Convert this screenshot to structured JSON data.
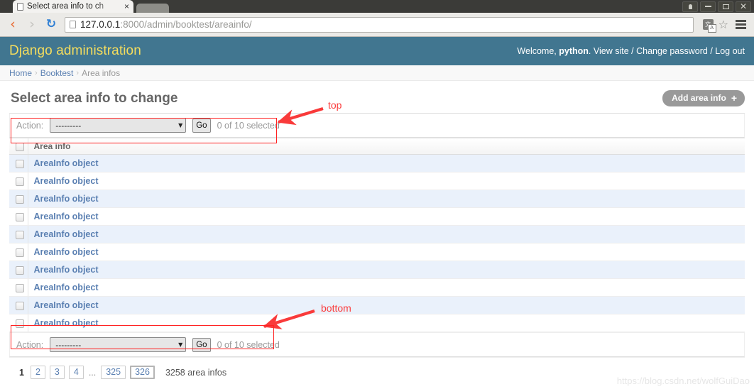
{
  "browser": {
    "tab": {
      "title": "Select area info to ch",
      "favicon": "page-icon",
      "close": "×"
    },
    "nav": {
      "back": "‹",
      "forward": "›",
      "reload": "↻"
    },
    "url": {
      "host": "127.0.0.1",
      "path": ":8000/admin/booktest/areainfo/"
    },
    "actions_right": {
      "translate": "文",
      "bookmark": "☆",
      "menu": "menu"
    },
    "window": {
      "user": "user",
      "minimize": "minimize",
      "maximize": "maximize",
      "close": "✕"
    }
  },
  "header": {
    "branding": "Django administration",
    "welcome_prefix": "Welcome, ",
    "username": "python",
    "welcome_suffix": ". ",
    "links": [
      {
        "label": "View site"
      },
      {
        "label": "Change password"
      },
      {
        "label": "Log out"
      }
    ],
    "link_sep": " / "
  },
  "breadcrumbs": {
    "sep": "›",
    "items": [
      {
        "label": "Home",
        "link": true
      },
      {
        "label": "Booktest",
        "link": true
      },
      {
        "label": "Area infos",
        "link": false
      }
    ]
  },
  "page": {
    "title": "Select area info to change",
    "add_button": {
      "label": "Add area info",
      "plus": "+"
    }
  },
  "action_bar": {
    "label": "Action:",
    "select_value": "---------",
    "caret": "▼",
    "go_label": "Go",
    "counter": "0 of 10 selected"
  },
  "table": {
    "columns": [
      "Area info"
    ],
    "rows": [
      {
        "label": "AreaInfo object"
      },
      {
        "label": "AreaInfo object"
      },
      {
        "label": "AreaInfo object"
      },
      {
        "label": "AreaInfo object"
      },
      {
        "label": "AreaInfo object"
      },
      {
        "label": "AreaInfo object"
      },
      {
        "label": "AreaInfo object"
      },
      {
        "label": "AreaInfo object"
      },
      {
        "label": "AreaInfo object"
      },
      {
        "label": "AreaInfo object"
      }
    ]
  },
  "paginator": {
    "current": "1",
    "pages": [
      "2",
      "3",
      "4"
    ],
    "ellipsis": "...",
    "tail_pages": [
      "325"
    ],
    "end_page": "326",
    "total": "3258 area infos"
  },
  "annotations": {
    "top_label": "top",
    "bottom_label": "bottom"
  },
  "watermark": "https://blog.csdn.net/wolfGuiDao",
  "colors": {
    "django_header": "#417690",
    "branding": "#f5dd5d",
    "link": "#5b80b2",
    "row_alt": "#eaf1fb",
    "annotation": "#ff2222"
  }
}
